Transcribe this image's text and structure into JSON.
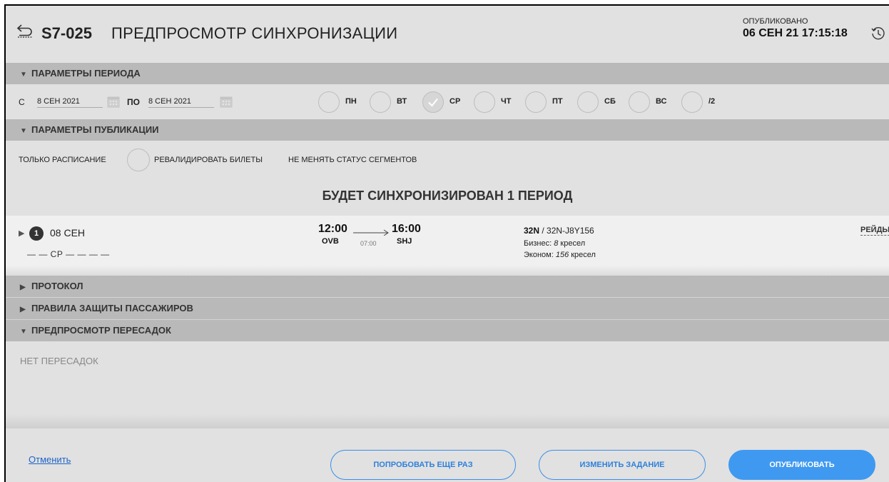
{
  "header": {
    "code": "S7-025",
    "title": "ПРЕДПРОСМОТР СИНХРОНИЗАЦИИ",
    "published_label": "ОПУБЛИКОВАНО",
    "published_date": "06 СЕН 21 17:15:18"
  },
  "period_params": {
    "section_title": "ПАРАМЕТРЫ ПЕРИОДА",
    "from_label": "С",
    "from_date": "8 СЕН 2021",
    "to_label": "ПО",
    "to_date": "8 СЕН 2021",
    "days": [
      {
        "label": "ПН",
        "checked": false
      },
      {
        "label": "ВТ",
        "checked": false
      },
      {
        "label": "СР",
        "checked": true
      },
      {
        "label": "ЧТ",
        "checked": false
      },
      {
        "label": "ПТ",
        "checked": false
      },
      {
        "label": "СБ",
        "checked": false
      },
      {
        "label": "ВС",
        "checked": false
      },
      {
        "label": "/2",
        "checked": false
      }
    ]
  },
  "publish_params": {
    "section_title": "ПАРАМЕТРЫ ПУБЛИКАЦИИ",
    "schedule_only": "ТОЛЬКО РАСПИСАНИЕ",
    "revalidate": "РЕВАЛИДИРОВАТЬ БИЛЕТЫ",
    "keep_status": "НЕ МЕНЯТЬ СТАТУС СЕГМЕНТОВ"
  },
  "sync": {
    "title": "БУДЕТ СИНХРОНИЗИРОВАН 1 ПЕРИОД",
    "period": {
      "index": "1",
      "date": "08 СЕН",
      "days_pattern": "— — СР — — — —",
      "dep_time": "12:00",
      "dep_airport": "OVB",
      "duration": "07:00",
      "arr_time": "16:00",
      "arr_airport": "SHJ",
      "aircraft_type": "32N",
      "aircraft_config": " / 32N-J8Y156",
      "business_label": "Бизнес: ",
      "business_seats": "8",
      "business_unit": " кресел",
      "economy_label": "Эконом: ",
      "economy_seats": "156",
      "economy_unit": " кресел",
      "flights_link": "РЕЙДЫ"
    }
  },
  "sections": {
    "protocol": "ПРОТОКОЛ",
    "passenger_rules": "ПРАВИЛА ЗАЩИТЫ ПАССАЖИРОВ",
    "connections_preview": "ПРЕДПРОСМОТР ПЕРЕСАДОК",
    "no_connections": "НЕТ ПЕРЕСАДОК"
  },
  "footer": {
    "cancel": "Отменить",
    "retry": "ПОПРОБОВАТЬ ЕЩЕ РАЗ",
    "edit_task": "ИЗМЕНИТЬ ЗАДАНИЕ",
    "publish": "ОПУБЛИКОВАТЬ"
  },
  "colors": {
    "primary": "#3f99f0",
    "link": "#1e63c9",
    "section_bar": "#b9b9b9",
    "background": "#e1e1e1"
  },
  "icons": [
    "back-icon",
    "history-icon",
    "calendar-icon",
    "check-icon",
    "arrow-right-icon"
  ]
}
